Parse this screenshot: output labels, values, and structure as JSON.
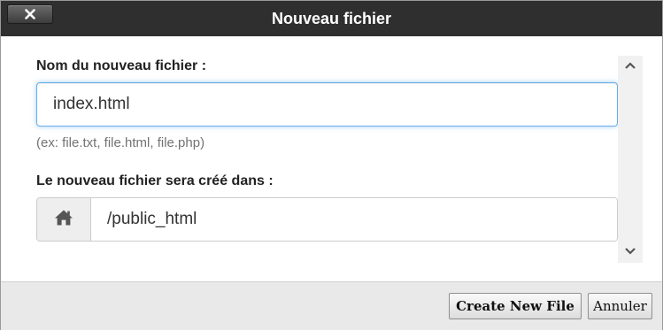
{
  "dialog": {
    "title": "Nouveau fichier",
    "close_icon": "close-icon"
  },
  "form": {
    "filename_label": "Nom du nouveau fichier :",
    "filename_value": "index.html",
    "filename_hint": "(ex: file.txt, file.html, file.php)",
    "location_label": "Le nouveau fichier sera créé dans :",
    "location_icon": "home-icon",
    "location_value": "/public_html"
  },
  "scrollbar": {
    "up_icon": "chevron-up-icon",
    "down_icon": "chevron-down-icon"
  },
  "footer": {
    "create_label": "Create New File",
    "cancel_label": "Annuler"
  },
  "colors": {
    "titlebar": "#2f2f2f",
    "focus_border": "#66afe9",
    "footer": "#e9e9e9"
  }
}
